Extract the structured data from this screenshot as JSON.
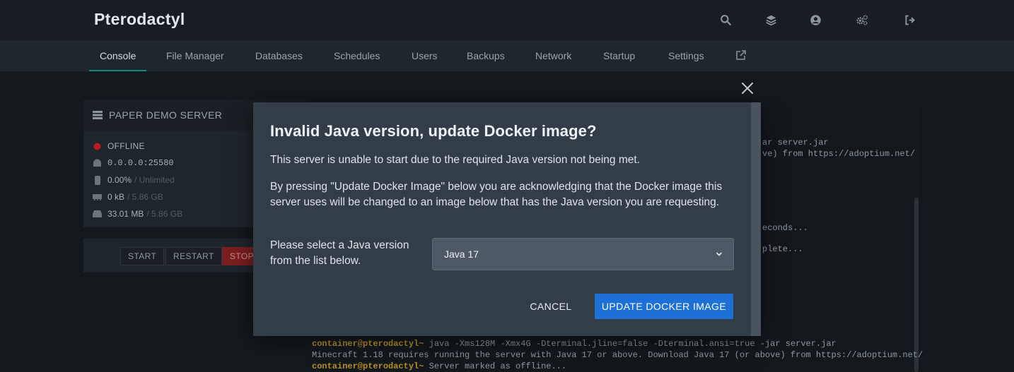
{
  "header": {
    "brand": "Pterodactyl",
    "icons": [
      "search-icon",
      "layers-icon",
      "account-icon",
      "admin-cogs-icon",
      "logout-icon"
    ]
  },
  "nav": {
    "tabs": [
      {
        "label": "Console",
        "active": true
      },
      {
        "label": "File Manager"
      },
      {
        "label": "Databases"
      },
      {
        "label": "Schedules"
      },
      {
        "label": "Users"
      },
      {
        "label": "Backups"
      },
      {
        "label": "Network"
      },
      {
        "label": "Startup"
      },
      {
        "label": "Settings"
      }
    ],
    "external_icon": "external-link-icon"
  },
  "server": {
    "name": "PAPER DEMO SERVER",
    "status": "OFFLINE",
    "status_color": "#b91c1c",
    "address": "0.0.0.0:25580",
    "cpu": "0.00%",
    "cpu_limit": "/ Unlimited",
    "memory": "0 kB",
    "memory_limit": "/ 5.86 GB",
    "disk": "33.01 MB",
    "disk_limit": "/ 5.86 GB"
  },
  "power": {
    "start": "START",
    "restart": "RESTART",
    "stop": "STOP"
  },
  "terminal": {
    "peek": [
      "ar server.jar",
      "ve) from https://adoptium.net/",
      "econds...",
      "plete..."
    ],
    "lines": [
      {
        "prompt": "container@pterodactyl~",
        "text": " java -Xms128M -Xmx4G -Dterminal.jline=false -Dterminal.ansi=true -jar server.jar"
      },
      {
        "prompt": "",
        "text": "Minecraft 1.18 requires running the server with Java 17 or above. Download Java 17 (or above) from https://adoptium.net/"
      },
      {
        "prompt": "container@pterodactyl~",
        "text": " Server marked as offline..."
      }
    ]
  },
  "modal": {
    "title": "Invalid Java version, update Docker image?",
    "paragraph1": "This server is unable to start due to the required Java version not being met.",
    "paragraph2": "By pressing \"Update Docker Image\" below you are acknowledging that the Docker image this server uses will be changed to an image below that has the Java version you are requesting.",
    "select_label": "Please select a Java version from the list below.",
    "select_value": "Java 17",
    "cancel_label": "CANCEL",
    "update_label": "UPDATE DOCKER IMAGE",
    "accent_color": "#1c70d6"
  }
}
